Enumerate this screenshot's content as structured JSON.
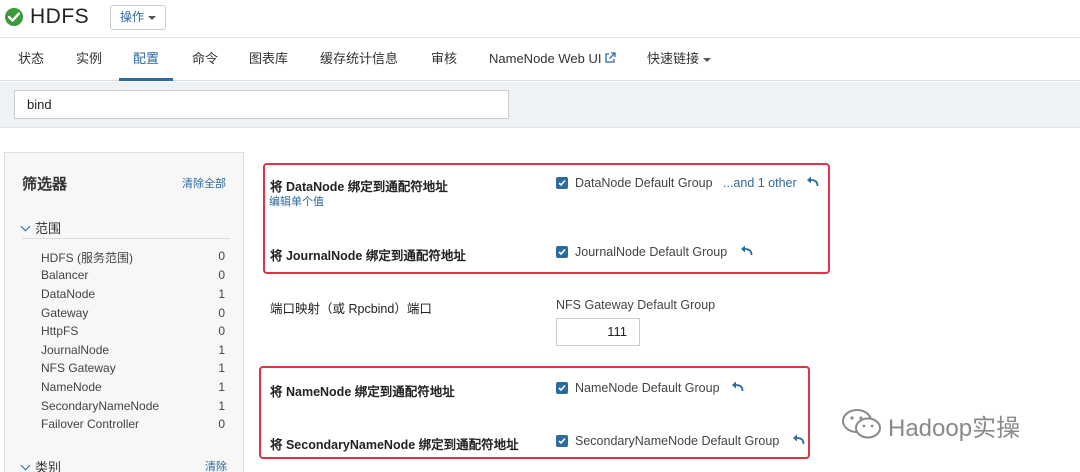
{
  "header": {
    "service_name": "HDFS",
    "actions_label": "操作"
  },
  "tabs": [
    {
      "label": "状态"
    },
    {
      "label": "实例"
    },
    {
      "label": "配置"
    },
    {
      "label": "命令"
    },
    {
      "label": "图表库"
    },
    {
      "label": "缓存统计信息"
    },
    {
      "label": "审核"
    },
    {
      "label": "NameNode Web UI"
    },
    {
      "label": "快速链接"
    }
  ],
  "search": {
    "value": "bind"
  },
  "filters": {
    "title": "筛选器",
    "clear_all": "清除全部",
    "scope_title": "范围",
    "scope_items": [
      {
        "name": "HDFS (服务范围)",
        "count": "0"
      },
      {
        "name": "Balancer",
        "count": "0"
      },
      {
        "name": "DataNode",
        "count": "1"
      },
      {
        "name": "Gateway",
        "count": "0"
      },
      {
        "name": "HttpFS",
        "count": "0"
      },
      {
        "name": "JournalNode",
        "count": "1"
      },
      {
        "name": "NFS Gateway",
        "count": "1"
      },
      {
        "name": "NameNode",
        "count": "1"
      },
      {
        "name": "SecondaryNameNode",
        "count": "1"
      },
      {
        "name": "Failover Controller",
        "count": "0"
      }
    ],
    "category_title": "类别",
    "category_clear": "清除"
  },
  "properties": [
    {
      "label": "将 DataNode 绑定到通配符地址",
      "edit_link": "编辑单个值",
      "group": "DataNode Default Group",
      "other": "...and 1 other"
    },
    {
      "label": "将 JournalNode 绑定到通配符地址",
      "group": "JournalNode Default Group"
    },
    {
      "label": "端口映射（或 Rpcbind）端口",
      "group": "NFS Gateway Default Group",
      "value": "111"
    },
    {
      "label": "将 NameNode 绑定到通配符地址",
      "group": "NameNode Default Group"
    },
    {
      "label": "将 SecondaryNameNode 绑定到通配符地址",
      "group": "SecondaryNameNode Default Group"
    }
  ],
  "watermark": {
    "text": "Hadoop实操"
  },
  "colors": {
    "accent": "#2c6aa0",
    "status_ok": "#3b9a3b",
    "highlight": "#e03444"
  },
  "icons": {
    "status": "check-circle-icon",
    "external": "external-link-icon",
    "undo": "undo-arrow-icon",
    "watermark": "wechat-icon"
  }
}
